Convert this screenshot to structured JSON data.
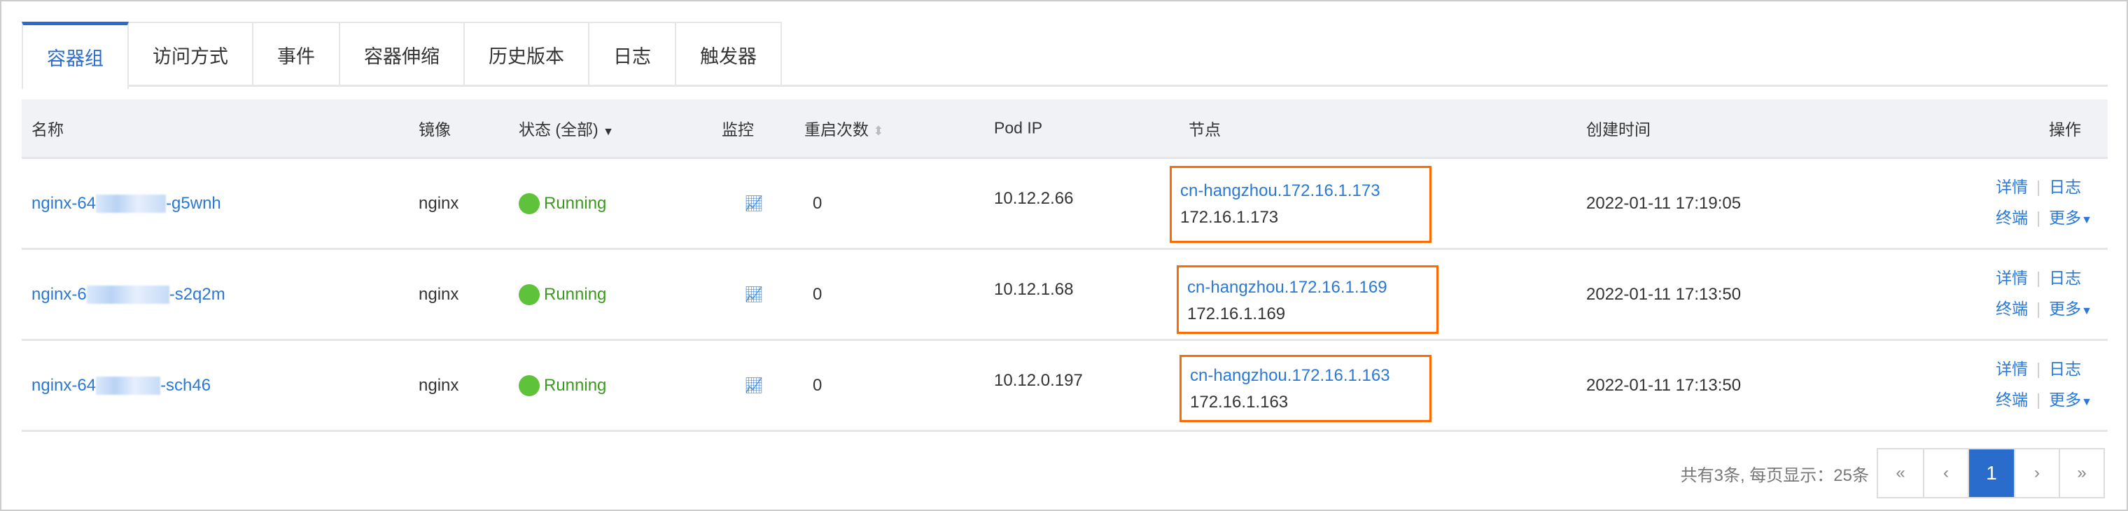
{
  "tabs": [
    {
      "label": "容器组",
      "active": true
    },
    {
      "label": "访问方式"
    },
    {
      "label": "事件"
    },
    {
      "label": "容器伸缩"
    },
    {
      "label": "历史版本"
    },
    {
      "label": "日志"
    },
    {
      "label": "触发器"
    }
  ],
  "columns": {
    "name": "名称",
    "image": "镜像",
    "status": "状态 (全部)",
    "monitor": "监控",
    "restarts": "重启次数",
    "pod_ip": "Pod IP",
    "node": "节点",
    "created": "创建时间",
    "actions": "操作"
  },
  "rows": [
    {
      "name_prefix": "nginx-64",
      "name_suffix": "-g5wnh",
      "image": "nginx",
      "status": "Running",
      "restarts": "0",
      "pod_ip": "10.12.2.66",
      "node_name": "cn-hangzhou.172.16.1.173",
      "node_ip": "172.16.1.173",
      "created": "2022-01-11 17:19:05"
    },
    {
      "name_prefix": "nginx-6",
      "name_suffix": "-s2q2m",
      "image": "nginx",
      "status": "Running",
      "restarts": "0",
      "pod_ip": "10.12.1.68",
      "node_name": "cn-hangzhou.172.16.1.169",
      "node_ip": "172.16.1.169",
      "created": "2022-01-11 17:13:50"
    },
    {
      "name_prefix": "nginx-64",
      "name_suffix": "-sch46",
      "image": "nginx",
      "status": "Running",
      "restarts": "0",
      "pod_ip": "10.12.0.197",
      "node_name": "cn-hangzhou.172.16.1.163",
      "node_ip": "172.16.1.163",
      "created": "2022-01-11 17:13:50"
    }
  ],
  "actions": {
    "detail": "详情",
    "logs": "日志",
    "terminal": "终端",
    "more": "更多"
  },
  "pagination": {
    "total_text": "共有3条, 每页显示：25条",
    "first": "«",
    "prev": "‹",
    "current": "1",
    "next": "›",
    "last": "»"
  },
  "colors": {
    "accent": "#2a6ccb",
    "link": "#2a78d6",
    "running": "#5ec23b",
    "highlight": "#ff6a00"
  }
}
